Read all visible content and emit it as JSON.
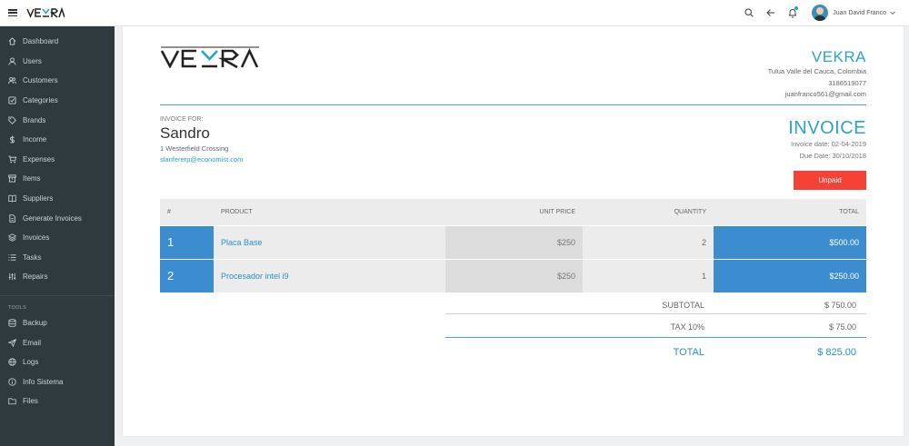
{
  "app": {
    "brand": "VEKRA",
    "user_name": "Juan David Franco"
  },
  "sidebar": {
    "items": [
      {
        "label": "Dashboard",
        "icon": "home-icon"
      },
      {
        "label": "Users",
        "icon": "user-icon"
      },
      {
        "label": "Customers",
        "icon": "users-icon"
      },
      {
        "label": "Categories",
        "icon": "check-square-icon"
      },
      {
        "label": "Brands",
        "icon": "tag-icon"
      },
      {
        "label": "Income",
        "icon": "dollar-icon"
      },
      {
        "label": "Expenses",
        "icon": "cart-icon"
      },
      {
        "label": "Items",
        "icon": "archive-icon"
      },
      {
        "label": "Suppliers",
        "icon": "book-icon"
      },
      {
        "label": "Generate Invoices",
        "icon": "file-icon"
      },
      {
        "label": "Invoices",
        "icon": "layers-icon"
      },
      {
        "label": "Tasks",
        "icon": "list-icon"
      },
      {
        "label": "Repairs",
        "icon": "sliders-icon"
      }
    ],
    "tools_label": "TOOLS",
    "tools": [
      {
        "label": "Backup",
        "icon": "database-icon"
      },
      {
        "label": "Email",
        "icon": "send-icon"
      },
      {
        "label": "Logs",
        "icon": "globe-icon"
      },
      {
        "label": "Info Sistema",
        "icon": "info-icon"
      },
      {
        "label": "Files",
        "icon": "folder-icon"
      }
    ]
  },
  "company": {
    "name": "VEKRA",
    "address": "Tulua Valle del Cauca, Colombia",
    "phone": "3186519077",
    "email": "juanfranco561@gmail.com"
  },
  "bill_to": {
    "label": "INVOICE FOR:",
    "name": "Sandro",
    "address": "1 Westerfield Crossing",
    "email": "slanfererp@economist.com"
  },
  "invoice": {
    "title": "INVOICE",
    "date": "Invoice date: 02-04-2019",
    "due": "Due Date: 30/10/2018",
    "status": "Unpaid"
  },
  "table": {
    "headers": [
      "#",
      "PRODUCT",
      "UNIT PRICE",
      "QUANTITY",
      "TOTAL"
    ],
    "rows": [
      {
        "n": "1",
        "product": "Placa Base",
        "price": "$250",
        "qty": "2",
        "total": "$500.00"
      },
      {
        "n": "2",
        "product": "Procesador intel i9",
        "price": "$250",
        "qty": "1",
        "total": "$250.00"
      }
    ]
  },
  "summary": {
    "subtotal_label": "SUBTOTAL",
    "subtotal": "$ 750.00",
    "tax_label": "TAX 10%",
    "tax": "$ 75.00",
    "total_label": "TOTAL",
    "total": "$ 825.00"
  },
  "colors": {
    "accent": "#29a3c8",
    "sidebar": "#2f3a3f",
    "table_blue": "#3c8dcf",
    "status_red": "#f44336"
  }
}
